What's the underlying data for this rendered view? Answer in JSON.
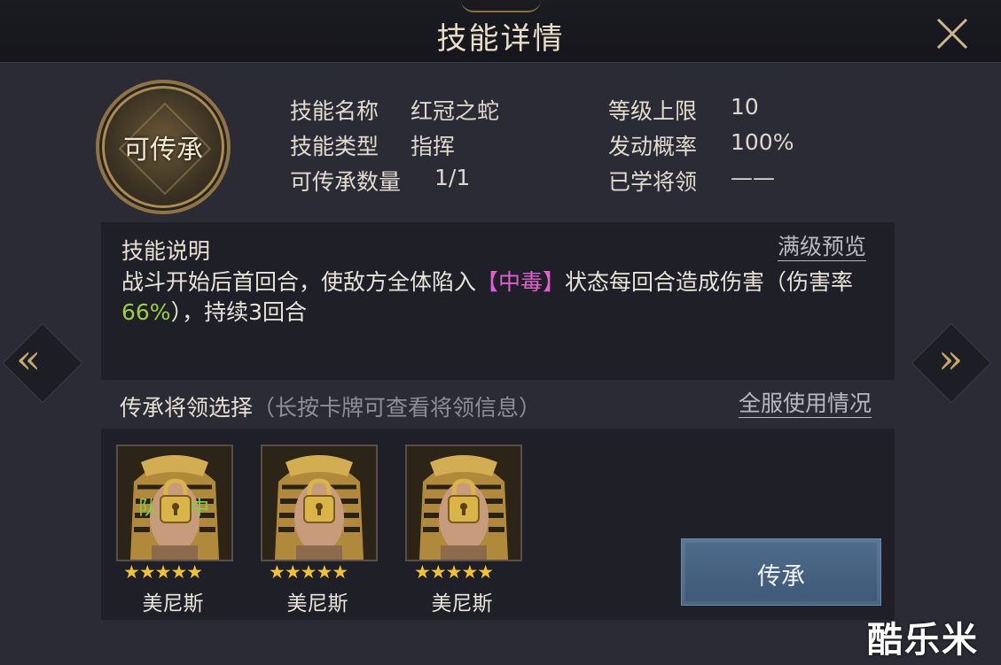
{
  "header": {
    "title": "技能详情",
    "close_icon": "close-icon"
  },
  "emblem": {
    "label": "可传承"
  },
  "info": {
    "left": [
      {
        "label": "技能名称",
        "value": "红冠之蛇"
      },
      {
        "label": "技能类型",
        "value": "指挥"
      },
      {
        "label": "可传承数量",
        "value": "1/1"
      }
    ],
    "right": [
      {
        "label": "等级上限",
        "value": "10"
      },
      {
        "label": "发动概率",
        "value": "100%"
      },
      {
        "label": "已学将领",
        "value": "——"
      }
    ]
  },
  "description": {
    "heading": "技能说明",
    "full_level_preview": "满级预览",
    "text_part1": "战斗开始后首回合，使敌方全体陷入",
    "status_effect": "【中毒】",
    "text_part2": "状态每回合造成伤害（伤害率",
    "damage_rate": "66%",
    "text_part3": "），持续3回合"
  },
  "selection": {
    "heading": "传承将领选择",
    "hint": "（长按卡牌可查看将领信息）",
    "server_usage": "全服使用情况"
  },
  "generals": [
    {
      "name": "美尼斯",
      "stars": "★★★★★",
      "tag_left": "队",
      "tag_right": "中",
      "locked": true
    },
    {
      "name": "美尼斯",
      "stars": "★★★★★",
      "locked": true
    },
    {
      "name": "美尼斯",
      "stars": "★★★★★",
      "locked": true
    }
  ],
  "actions": {
    "inherit_label": "传承"
  },
  "nav": {
    "prev_icon": "chevron-left-double-icon",
    "next_icon": "chevron-right-double-icon"
  },
  "watermark": "酷乐米",
  "colors": {
    "accent_gold": "#c6a86a",
    "poison": "#e060d0",
    "rate_green": "#9ad23c",
    "button_blue": "#4f6c8c"
  }
}
